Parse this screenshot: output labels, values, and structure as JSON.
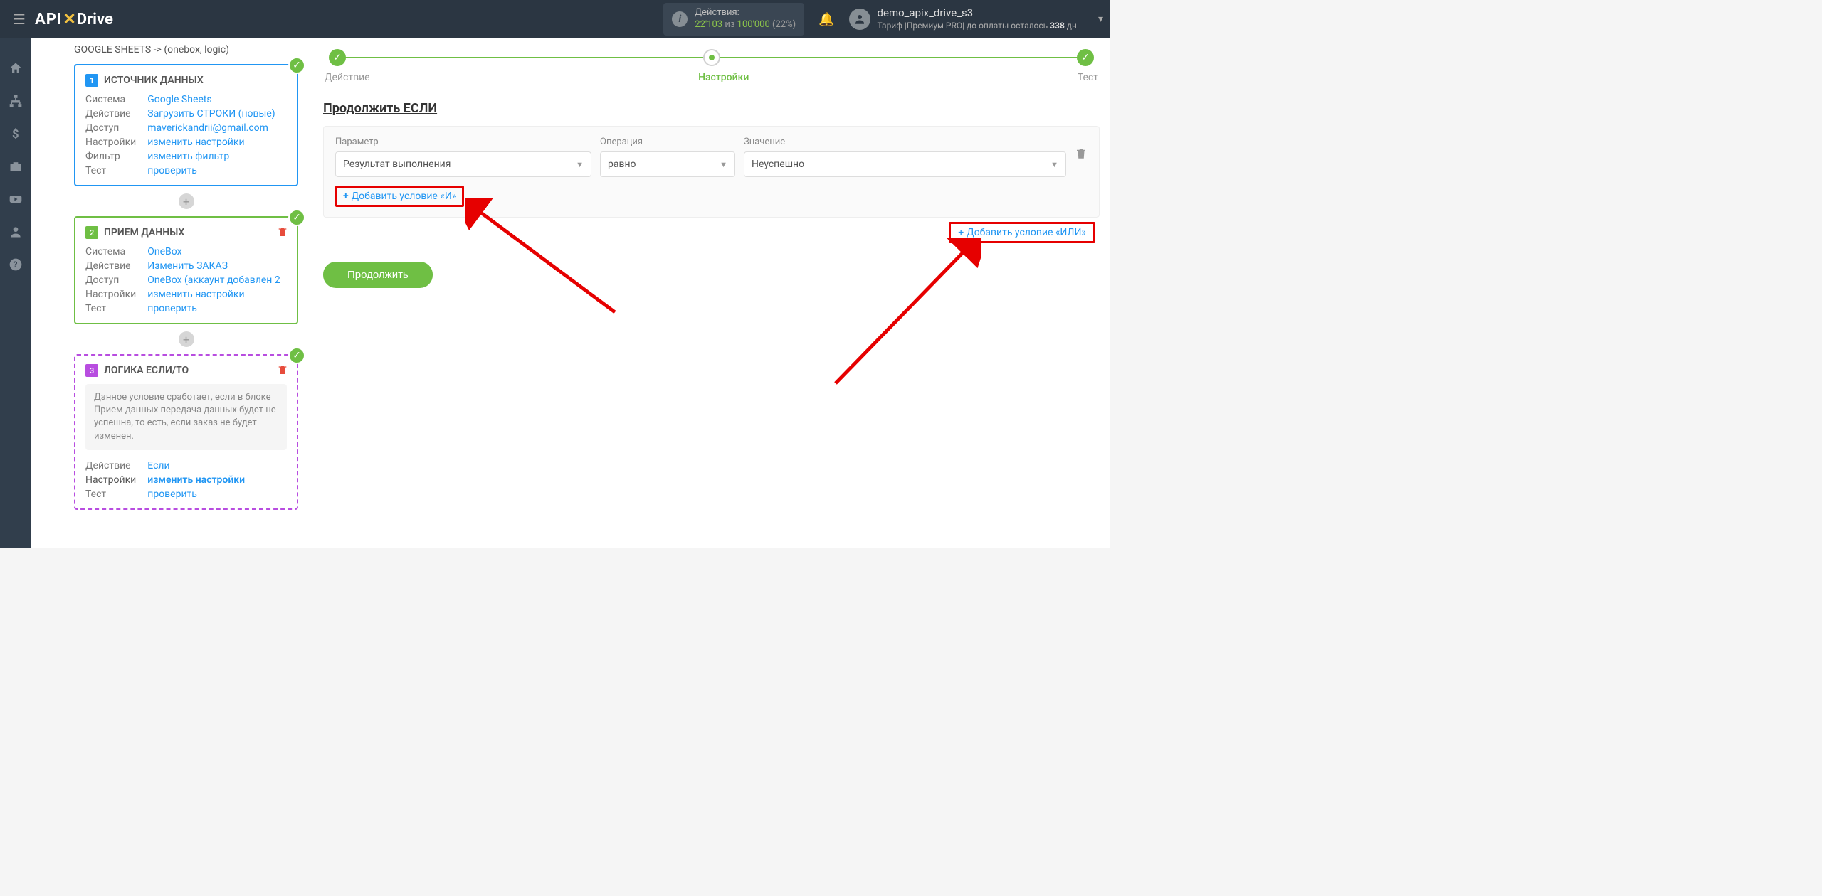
{
  "navbar": {
    "actions_label": "Действия:",
    "actions_cur": "22'103",
    "actions_of": "из",
    "actions_max": "100'000",
    "actions_pct": "(22%)",
    "user_name": "demo_apix_drive_s3",
    "tariff_prefix": "Тариф |Премиум PRO| до оплаты осталось ",
    "tariff_days": "338",
    "tariff_suffix": " дн"
  },
  "panel": {
    "title": "GOOGLE SHEETS -> (onebox, logic)",
    "block1": {
      "num": "1",
      "title": "ИСТОЧНИК ДАННЫХ",
      "labels": {
        "system": "Система",
        "action": "Действие",
        "access": "Доступ",
        "settings": "Настройки",
        "filter": "Фильтр",
        "test": "Тест"
      },
      "values": {
        "system": "Google Sheets",
        "action": "Загрузить СТРОКИ (новые)",
        "access": "maverickandrii@gmail.com",
        "settings": "изменить настройки",
        "filter": "изменить фильтр",
        "test": "проверить"
      }
    },
    "block2": {
      "num": "2",
      "title": "ПРИЕМ ДАННЫХ",
      "labels": {
        "system": "Система",
        "action": "Действие",
        "access": "Доступ",
        "settings": "Настройки",
        "test": "Тест"
      },
      "values": {
        "system": "OneBox",
        "action": "Изменить ЗАКАЗ",
        "access": "OneBox (аккаунт добавлен 2",
        "settings": "изменить настройки",
        "test": "проверить"
      }
    },
    "block3": {
      "num": "3",
      "title": "ЛОГИКА ЕСЛИ/ТО",
      "desc": "Данное условие сработает, если в блоке Прием данных передача данных будет не успешна, то есть, если заказ не будет изменен.",
      "labels": {
        "action": "Действие",
        "settings": "Настройки",
        "test": "Тест"
      },
      "values": {
        "action": "Если",
        "settings": "изменить настройки",
        "test": "проверить"
      }
    }
  },
  "wizard": {
    "step1": "Действие",
    "step2": "Настройки",
    "step3": "Тест"
  },
  "main": {
    "section_title": "Продолжить ЕСЛИ",
    "param_label": "Параметр",
    "op_label": "Операция",
    "val_label": "Значение",
    "param_value": "Результат выполнения",
    "op_value": "равно",
    "val_value": "Неуспешно",
    "add_and": "Добавить условие «И»",
    "add_or": "Добавить условие «ИЛИ»",
    "continue": "Продолжить"
  }
}
